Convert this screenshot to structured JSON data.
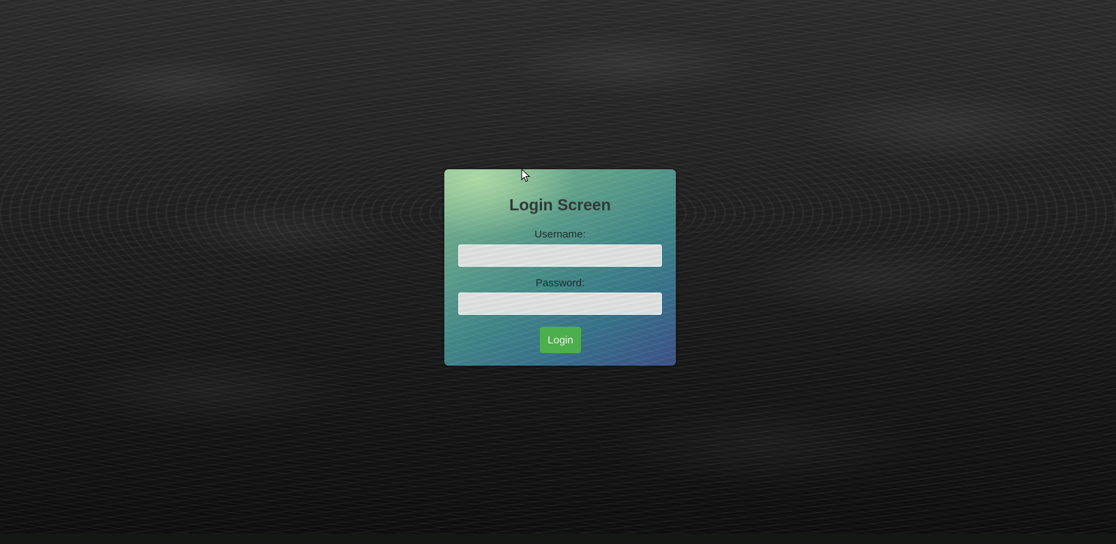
{
  "login": {
    "title": "Login Screen",
    "username_label": "Username:",
    "username_value": "",
    "password_label": "Password:",
    "password_value": "",
    "button_label": "Login"
  },
  "colors": {
    "button": "#4cae4c",
    "title_text": "#2e3a3a",
    "background": "#1a1a1a"
  },
  "icons": {
    "cursor": "mouse-pointer-icon"
  }
}
